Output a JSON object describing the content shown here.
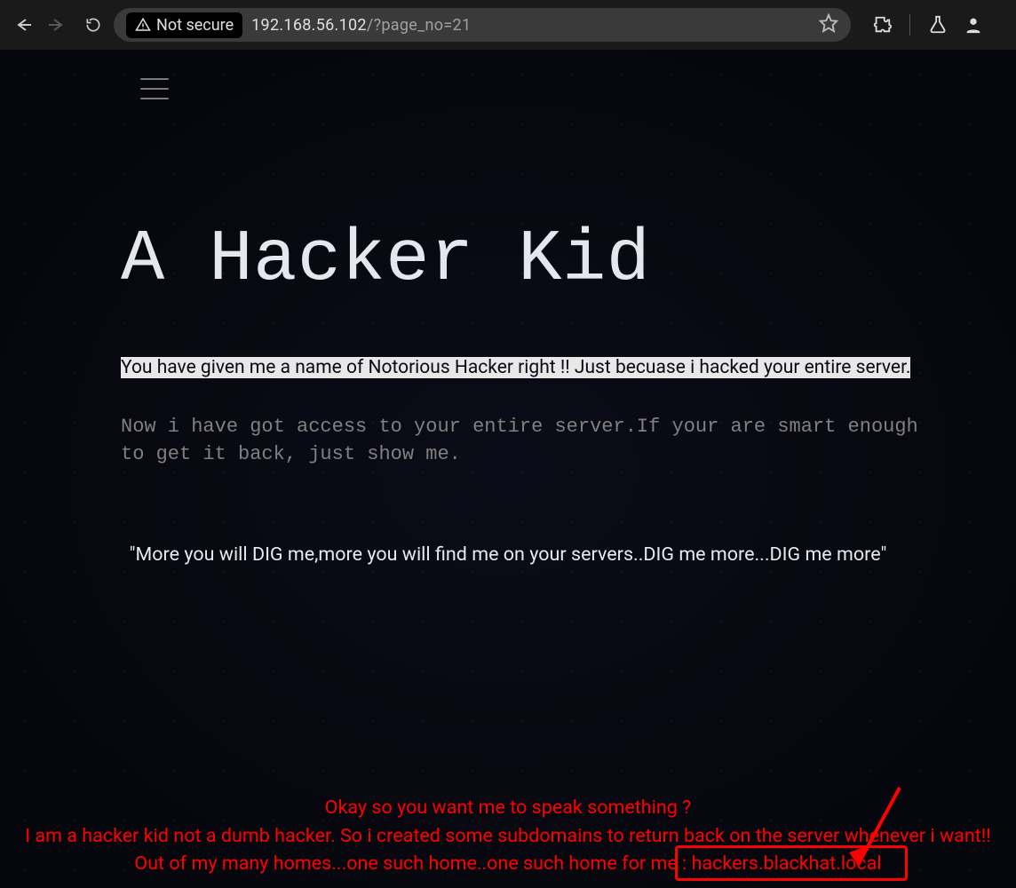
{
  "browser": {
    "security_label": "Not secure",
    "url_host": "192.168.56.102",
    "url_path": "/?page_no=21"
  },
  "page": {
    "title": "A Hacker Kid",
    "highlighted_line": "You have given me a name of Notorious Hacker right !! Just becuase i hacked your entire server.",
    "dim_line": "Now i have got access to your entire server.If your are smart enough to get it back, just show me.",
    "dig_line": "\"More you will DIG me,more you will find me on your servers..DIG me more...DIG me more\"",
    "speak": {
      "l1": "Okay so you want me to speak something ?",
      "l2": "I am a hacker kid not a dumb hacker. So i created some subdomains to return back on the server whenever i want!!",
      "l3": "Out of my many homes...one such home..one such home for me : hackers.blackhat.local"
    }
  },
  "annotation": {
    "boxed_value": "hackers.blackhat.local"
  },
  "colors": {
    "red": "#ff0000"
  }
}
